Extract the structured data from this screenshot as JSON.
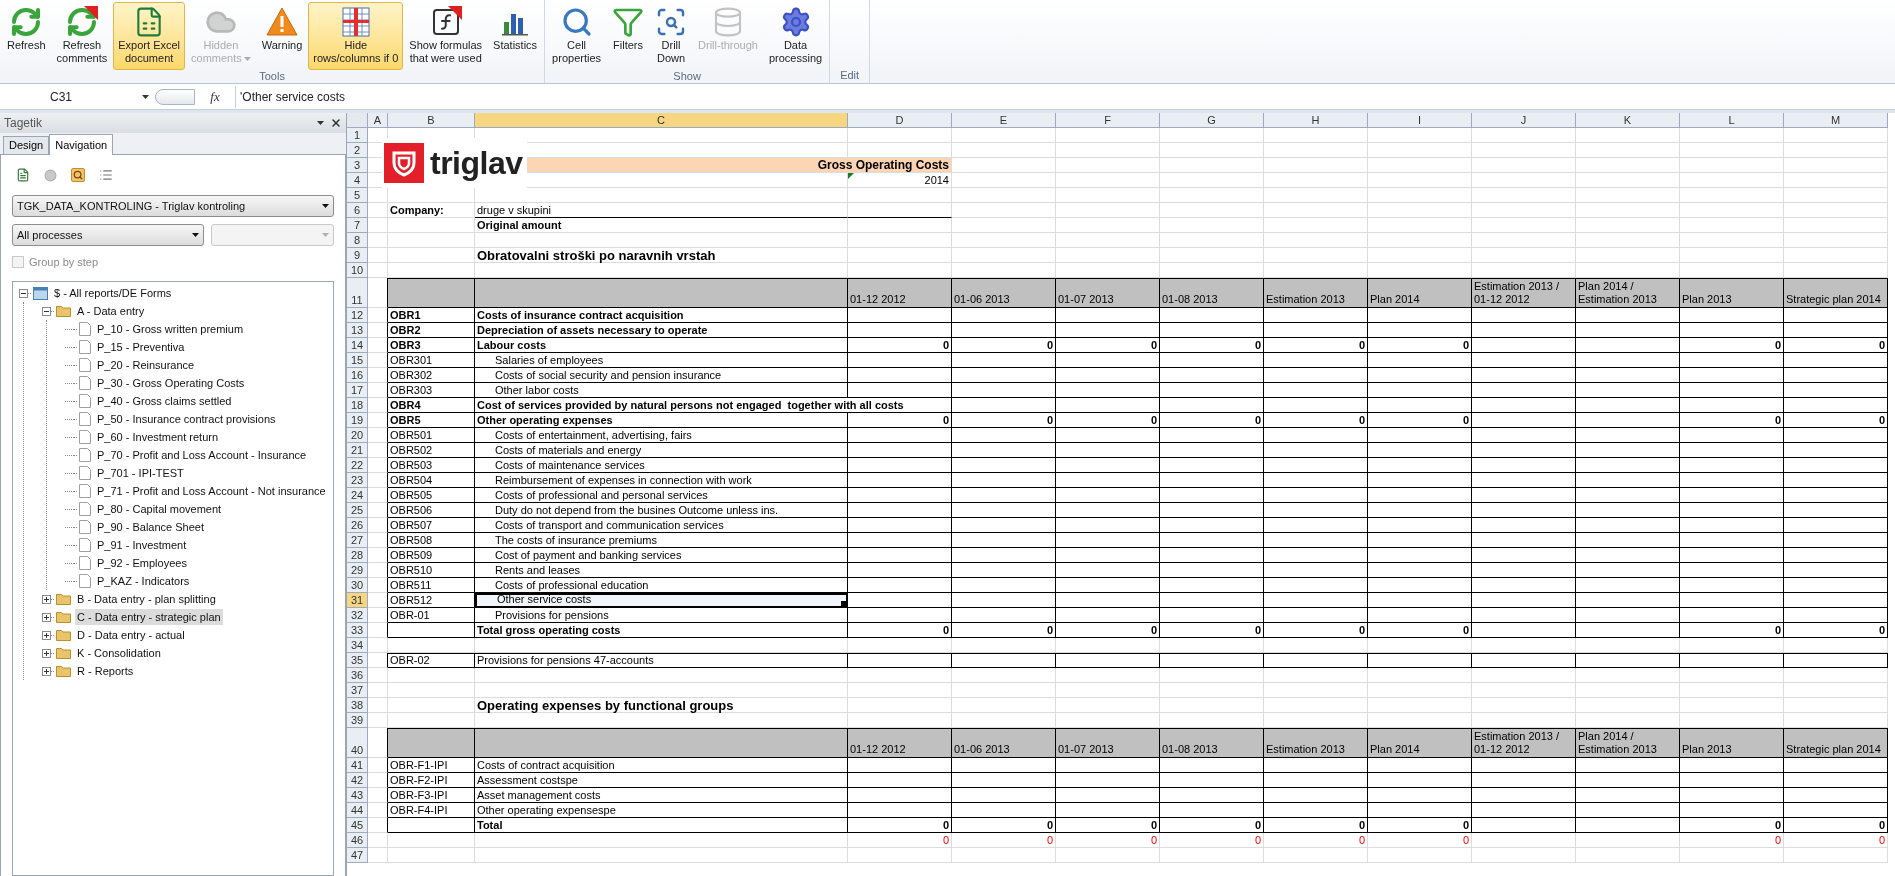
{
  "ribbon": {
    "groups": [
      {
        "label": "Tools",
        "buttons": [
          {
            "lines": [
              "Refresh"
            ],
            "disabled": false,
            "highlighted": false,
            "dropdown": false
          },
          {
            "lines": [
              "Refresh",
              "comments"
            ],
            "disabled": false,
            "highlighted": false,
            "dropdown": false
          },
          {
            "lines": [
              "Export Excel",
              "document"
            ],
            "disabled": false,
            "highlighted": true,
            "dropdown": false
          },
          {
            "lines": [
              "Hidden",
              "comments"
            ],
            "disabled": true,
            "highlighted": false,
            "dropdown": true
          },
          {
            "lines": [
              "Warning"
            ],
            "disabled": false,
            "highlighted": false,
            "dropdown": false
          },
          {
            "lines": [
              "Hide",
              "rows/columns if 0"
            ],
            "disabled": false,
            "highlighted": true,
            "dropdown": false
          },
          {
            "lines": [
              "Show formulas",
              "that were used"
            ],
            "disabled": false,
            "highlighted": false,
            "dropdown": false
          },
          {
            "lines": [
              "Statistics"
            ],
            "disabled": false,
            "highlighted": false,
            "dropdown": false
          }
        ]
      },
      {
        "label": "Show",
        "buttons": [
          {
            "lines": [
              "Cell",
              "properties"
            ],
            "disabled": false,
            "highlighted": false,
            "dropdown": false
          },
          {
            "lines": [
              "Filters"
            ],
            "disabled": false,
            "highlighted": false,
            "dropdown": false
          },
          {
            "lines": [
              "Drill",
              "Down"
            ],
            "disabled": false,
            "highlighted": false,
            "dropdown": false
          },
          {
            "lines": [
              "Drill-through"
            ],
            "disabled": true,
            "highlighted": false,
            "dropdown": false
          },
          {
            "lines": [
              "Data",
              "processing"
            ],
            "disabled": false,
            "highlighted": false,
            "dropdown": false
          }
        ]
      },
      {
        "label": "Edit"
      }
    ]
  },
  "formula_bar": {
    "name_box": "C31",
    "function_label": "fx",
    "formula": "'Other service costs"
  },
  "side_panel": {
    "title": "Tagetik",
    "tabs": [
      {
        "label": "Design",
        "selected": false
      },
      {
        "label": "Navigation",
        "selected": true
      }
    ],
    "model_select": {
      "value": "TGK_DATA_KONTROLING - Triglav kontroling"
    },
    "process_select": {
      "value": "All processes"
    },
    "step_select": {
      "disabled": true
    },
    "group_by_step": {
      "label": "Group by step",
      "checked": false,
      "disabled": true
    },
    "tree": [
      {
        "label": "$ - All reports/DE Forms",
        "kind": "root",
        "expanded": true,
        "selected": false,
        "children": [
          {
            "label": "A - Data entry",
            "kind": "folder",
            "expanded": true,
            "selected": false,
            "children": [
              {
                "label": "P_10 - Gross written premium",
                "kind": "report",
                "selected": false
              },
              {
                "label": "P_15 - Preventiva",
                "kind": "report",
                "selected": false
              },
              {
                "label": "P_20 - Reinsurance",
                "kind": "report",
                "selected": false
              },
              {
                "label": "P_30 - Gross Operating Costs",
                "kind": "report",
                "selected": false
              },
              {
                "label": "P_40 - Gross claims settled",
                "kind": "report",
                "selected": false
              },
              {
                "label": "P_50 - Insurance contract provisions",
                "kind": "report",
                "selected": false
              },
              {
                "label": "P_60 - Investment return",
                "kind": "report",
                "selected": false
              },
              {
                "label": "P_70 - Profit and Loss Account - Insurance",
                "kind": "report",
                "selected": false
              },
              {
                "label": "P_701 - IPI-TEST",
                "kind": "report",
                "selected": false
              },
              {
                "label": "P_71 - Profit and Loss Account - Not insurance",
                "kind": "report",
                "selected": false
              },
              {
                "label": "P_80 - Capital movement",
                "kind": "report",
                "selected": false
              },
              {
                "label": "P_90 - Balance Sheet",
                "kind": "report",
                "selected": false
              },
              {
                "label": "P_91 - Investment",
                "kind": "report",
                "selected": false
              },
              {
                "label": "P_92 - Employees",
                "kind": "report",
                "selected": false
              },
              {
                "label": "P_KAZ - Indicators",
                "kind": "report",
                "selected": false
              }
            ]
          },
          {
            "label": "B - Data entry - plan splitting",
            "kind": "folder",
            "expanded": false,
            "selected": false
          },
          {
            "label": "C - Data entry - strategic plan",
            "kind": "folder",
            "expanded": false,
            "selected": true
          },
          {
            "label": "D - Data entry - actual",
            "kind": "folder",
            "expanded": false,
            "selected": false
          },
          {
            "label": "K - Consolidation",
            "kind": "folder",
            "expanded": false,
            "selected": false
          },
          {
            "label": "R - Reports",
            "kind": "folder",
            "expanded": false,
            "selected": false
          }
        ]
      }
    ]
  },
  "sheet": {
    "columns": [
      {
        "label": "A",
        "selected": false
      },
      {
        "label": "B",
        "selected": false
      },
      {
        "label": "C",
        "selected": true
      },
      {
        "label": "D",
        "selected": false
      },
      {
        "label": "E",
        "selected": false
      },
      {
        "label": "F",
        "selected": false
      },
      {
        "label": "G",
        "selected": false
      },
      {
        "label": "H",
        "selected": false
      },
      {
        "label": "I",
        "selected": false
      },
      {
        "label": "J",
        "selected": false
      },
      {
        "label": "K",
        "selected": false
      },
      {
        "label": "L",
        "selected": false
      },
      {
        "label": "M",
        "selected": false
      }
    ],
    "row_numbers": [
      {
        "label": "1",
        "selected": false
      },
      {
        "label": "2",
        "selected": false
      },
      {
        "label": "3",
        "selected": false
      },
      {
        "label": "4",
        "selected": false
      },
      {
        "label": "5",
        "selected": false
      },
      {
        "label": "6",
        "selected": false
      },
      {
        "label": "7",
        "selected": false
      },
      {
        "label": "8",
        "selected": false
      },
      {
        "label": "9",
        "selected": false
      },
      {
        "label": "10",
        "selected": false
      },
      {
        "label": "11",
        "selected": false
      },
      {
        "label": "12",
        "selected": false
      },
      {
        "label": "13",
        "selected": false
      },
      {
        "label": "14",
        "selected": false
      },
      {
        "label": "15",
        "selected": false
      },
      {
        "label": "16",
        "selected": false
      },
      {
        "label": "17",
        "selected": false
      },
      {
        "label": "18",
        "selected": false
      },
      {
        "label": "19",
        "selected": false
      },
      {
        "label": "20",
        "selected": false
      },
      {
        "label": "21",
        "selected": false
      },
      {
        "label": "22",
        "selected": false
      },
      {
        "label": "23",
        "selected": false
      },
      {
        "label": "24",
        "selected": false
      },
      {
        "label": "25",
        "selected": false
      },
      {
        "label": "26",
        "selected": false
      },
      {
        "label": "27",
        "selected": false
      },
      {
        "label": "28",
        "selected": false
      },
      {
        "label": "29",
        "selected": false
      },
      {
        "label": "30",
        "selected": false
      },
      {
        "label": "31",
        "selected": true
      },
      {
        "label": "32",
        "selected": false
      },
      {
        "label": "33",
        "selected": false
      },
      {
        "label": "34",
        "selected": false
      },
      {
        "label": "35",
        "selected": false
      },
      {
        "label": "36",
        "selected": false
      },
      {
        "label": "37",
        "selected": false
      },
      {
        "label": "38",
        "selected": false
      },
      {
        "label": "39",
        "selected": false
      },
      {
        "label": "40",
        "selected": false
      },
      {
        "label": "41",
        "selected": false
      },
      {
        "label": "42",
        "selected": false
      },
      {
        "label": "43",
        "selected": false
      },
      {
        "label": "44",
        "selected": false
      },
      {
        "label": "45",
        "selected": false
      },
      {
        "label": "46",
        "selected": false
      },
      {
        "label": "47",
        "selected": false
      }
    ],
    "logo": {
      "text": "triglav"
    },
    "title": "Gross Operating Costs",
    "year": "2014",
    "company_label": "Company:",
    "company_value": "druge v skupini",
    "amount_type": "Original amount",
    "tables": [
      {
        "title": "Obratovalni stroški po naravnih vrstah",
        "columns": [
          "01-12 2012",
          "01-06 2013",
          "01-07 2013",
          "01-08 2013",
          "Estimation 2013",
          "Plan 2014",
          "Estimation 2013 / 01-12 2012",
          "Plan 2014 / Estimation 2013",
          "Plan 2013",
          "Strategic plan 2014"
        ],
        "rows": [
          {
            "code": "OBR1",
            "label": "Costs of insurance contract acquisition",
            "kind": "bold",
            "selected": false,
            "spills": false
          },
          {
            "code": "OBR2",
            "label": "Depreciation of assets necessary to operate",
            "kind": "bold",
            "selected": false,
            "spills": false
          },
          {
            "code": "OBR3",
            "label": "Labour costs",
            "kind": "bold",
            "selected": false,
            "spills": false,
            "values": {
              "0": "0",
              "1": "0",
              "2": "0",
              "3": "0",
              "4": "0",
              "5": "0",
              "8": "0",
              "9": "0"
            }
          },
          {
            "code": "OBR301",
            "label": "Salaries of employees",
            "kind": "item",
            "selected": false,
            "spills": false
          },
          {
            "code": "OBR302",
            "label": "Costs of social security and pension insurance",
            "kind": "item",
            "selected": false,
            "spills": false
          },
          {
            "code": "OBR303",
            "label": "Other labor costs",
            "kind": "item",
            "selected": false,
            "spills": false
          },
          {
            "code": "OBR4",
            "label": "Cost of services provided by natural persons not engaged  together with all costs",
            "kind": "bold",
            "selected": false,
            "spills": true
          },
          {
            "code": "OBR5",
            "label": "Other operating expenses",
            "kind": "bold",
            "selected": false,
            "spills": false,
            "values": {
              "0": "0",
              "1": "0",
              "2": "0",
              "3": "0",
              "4": "0",
              "5": "0",
              "8": "0",
              "9": "0"
            }
          },
          {
            "code": "OBR501",
            "label": "Costs of entertainment, advertising, fairs",
            "kind": "item",
            "selected": false,
            "spills": false
          },
          {
            "code": "OBR502",
            "label": "Costs of materials and energy",
            "kind": "item",
            "selected": false,
            "spills": false
          },
          {
            "code": "OBR503",
            "label": "Costs of maintenance services",
            "kind": "item",
            "selected": false,
            "spills": false
          },
          {
            "code": "OBR504",
            "label": "Reimbursement of expenses in connection with work",
            "kind": "item",
            "selected": false,
            "spills": false
          },
          {
            "code": "OBR505",
            "label": "Costs of professional and personal services",
            "kind": "item",
            "selected": false,
            "spills": false
          },
          {
            "code": "OBR506",
            "label": "Duty do not depend from the busines Outcome unless ins.",
            "kind": "item",
            "selected": false,
            "spills": false
          },
          {
            "code": "OBR507",
            "label": "Costs of transport and communication services",
            "kind": "item",
            "selected": false,
            "spills": false
          },
          {
            "code": "OBR508",
            "label": "The costs of insurance premiums",
            "kind": "item",
            "selected": false,
            "spills": false
          },
          {
            "code": "OBR509",
            "label": "Cost of payment and banking services",
            "kind": "item",
            "selected": false,
            "spills": false
          },
          {
            "code": "OBR510",
            "label": "Rents and leases",
            "kind": "item",
            "selected": false,
            "spills": false
          },
          {
            "code": "OBR511",
            "label": "Costs of professional education",
            "kind": "item",
            "selected": false,
            "spills": false
          },
          {
            "code": "OBR512",
            "label": "Other service costs",
            "kind": "item",
            "selected": true,
            "spills": false
          },
          {
            "code": "OBR-01",
            "label": "Provisions for pensions",
            "kind": "item",
            "selected": false,
            "spills": false
          },
          {
            "label": "Total gross operating costs",
            "kind": "total",
            "selected": false,
            "spills": false,
            "values": {
              "0": "0",
              "1": "0",
              "2": "0",
              "3": "0",
              "4": "0",
              "5": "0",
              "8": "0",
              "9": "0"
            }
          }
        ],
        "extra_rows": [
          {
            "code": "OBR-02",
            "label": "Provisions for pensions 47-accounts",
            "kind": "plain",
            "selected": false,
            "spills": false
          }
        ]
      },
      {
        "title": "Operating expenses by functional groups",
        "columns": [
          "01-12 2012",
          "01-06 2013",
          "01-07 2013",
          "01-08 2013",
          "Estimation 2013",
          "Plan 2014",
          "Estimation 2013 / 01-12 2012",
          "Plan 2014 / Estimation 2013",
          "Plan 2013",
          "Strategic plan 2014"
        ],
        "rows": [
          {
            "code": "OBR-F1-IPI",
            "label": "Costs of contract acquisition",
            "kind": "plain",
            "selected": false,
            "spills": false
          },
          {
            "code": "OBR-F2-IPI",
            "label": "Assessment costspe",
            "kind": "plain",
            "selected": false,
            "spills": false
          },
          {
            "code": "OBR-F3-IPI",
            "label": "Asset management costs",
            "kind": "plain",
            "selected": false,
            "spills": false
          },
          {
            "code": "OBR-F4-IPI",
            "label": "Other operating expensespe",
            "kind": "plain",
            "selected": false,
            "spills": false
          },
          {
            "label": "Total",
            "kind": "total",
            "selected": false,
            "spills": false,
            "values": {
              "0": "0",
              "1": "0",
              "2": "0",
              "3": "0",
              "4": "0",
              "5": "0",
              "8": "0",
              "9": "0"
            }
          }
        ],
        "check_row": {
          "values": {
            "0": "0",
            "1": "0",
            "2": "0",
            "3": "0",
            "4": "0",
            "5": "0",
            "8": "0",
            "9": "0"
          }
        }
      }
    ]
  }
}
